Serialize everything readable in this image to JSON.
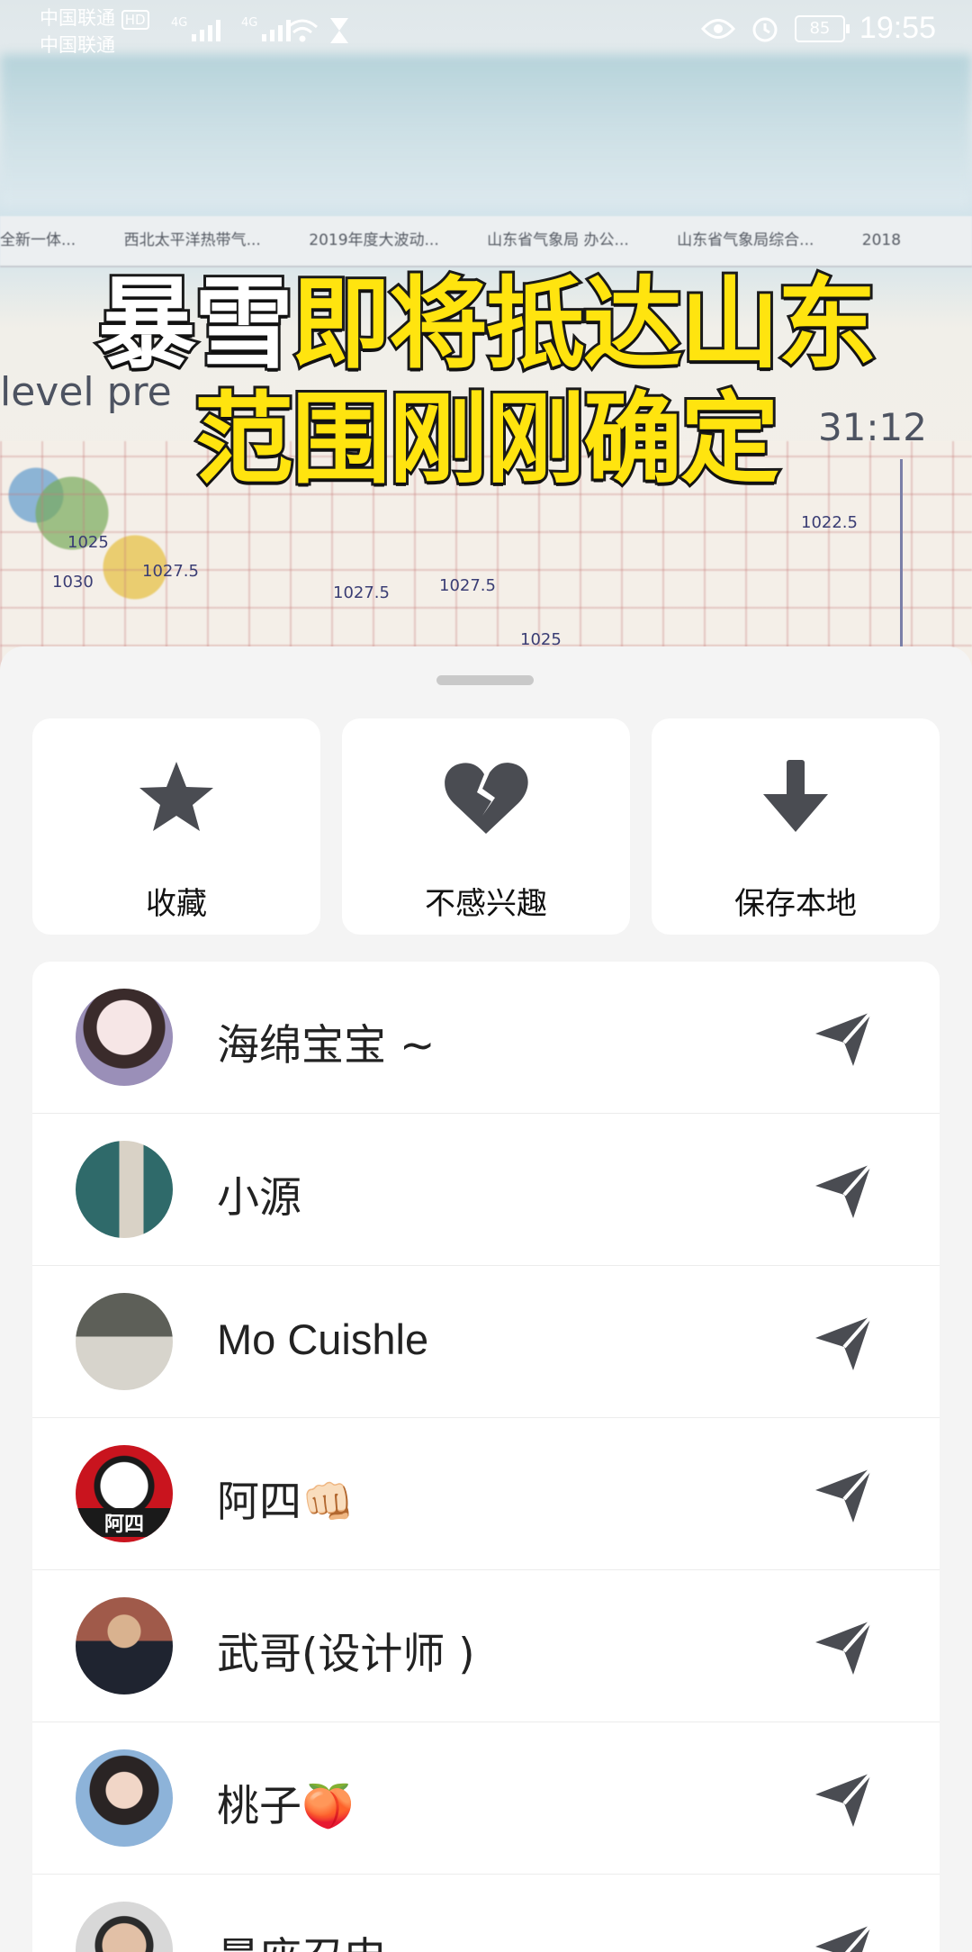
{
  "status_bar": {
    "carrier_1": "中国联通",
    "carrier_1_badge": "HD",
    "carrier_2": "中国联通",
    "network_1": "4G",
    "network_2": "4G",
    "battery": "85",
    "time": "19:55",
    "icons": [
      "signal-icon",
      "signal-icon",
      "wifi-icon",
      "hourglass-icon",
      "eye-icon",
      "alarm-icon",
      "battery-icon"
    ]
  },
  "video": {
    "headline_line1_white": "暴雪",
    "headline_line1_yellow": "即将抵达山东",
    "headline_line2": "范围刚刚确定",
    "overlay_left": "level pre",
    "overlay_right": "31:12",
    "browser_tabs": [
      "全新一体...",
      "西北太平洋热带气...",
      "2019年度大波动...",
      "山东省气象局 办公...",
      "山东省气象局综合...",
      "2018"
    ],
    "map_labels": [
      "1025",
      "1027.5",
      "1030",
      "1027.5",
      "1027.5",
      "1025",
      "1022.5"
    ]
  },
  "actions": [
    {
      "label": "收藏",
      "icon": "star-icon"
    },
    {
      "label": "不感兴趣",
      "icon": "broken-heart-icon"
    },
    {
      "label": "保存本地",
      "icon": "download-arrow-icon"
    }
  ],
  "contacts": [
    {
      "name": "海绵宝宝 ~",
      "avatar": "avatar-cartoon-girl"
    },
    {
      "name": "小源",
      "avatar": "avatar-painting"
    },
    {
      "name": "Mo Cuishle",
      "avatar": "avatar-glass"
    },
    {
      "name": "阿四👊🏻",
      "avatar": "avatar-red-cartoon",
      "avatar_text": "阿四"
    },
    {
      "name": "武哥(设计师 )",
      "avatar": "avatar-man-suit"
    },
    {
      "name": "桃子🍑",
      "avatar": "avatar-woman"
    },
    {
      "name": "晨座召申",
      "avatar": "avatar-man"
    }
  ],
  "colors": {
    "headline_yellow": "#ffe40f",
    "sheet_bg": "#f4f4f4",
    "card_bg": "#ffffff",
    "icon_gray": "#4a4c52"
  }
}
